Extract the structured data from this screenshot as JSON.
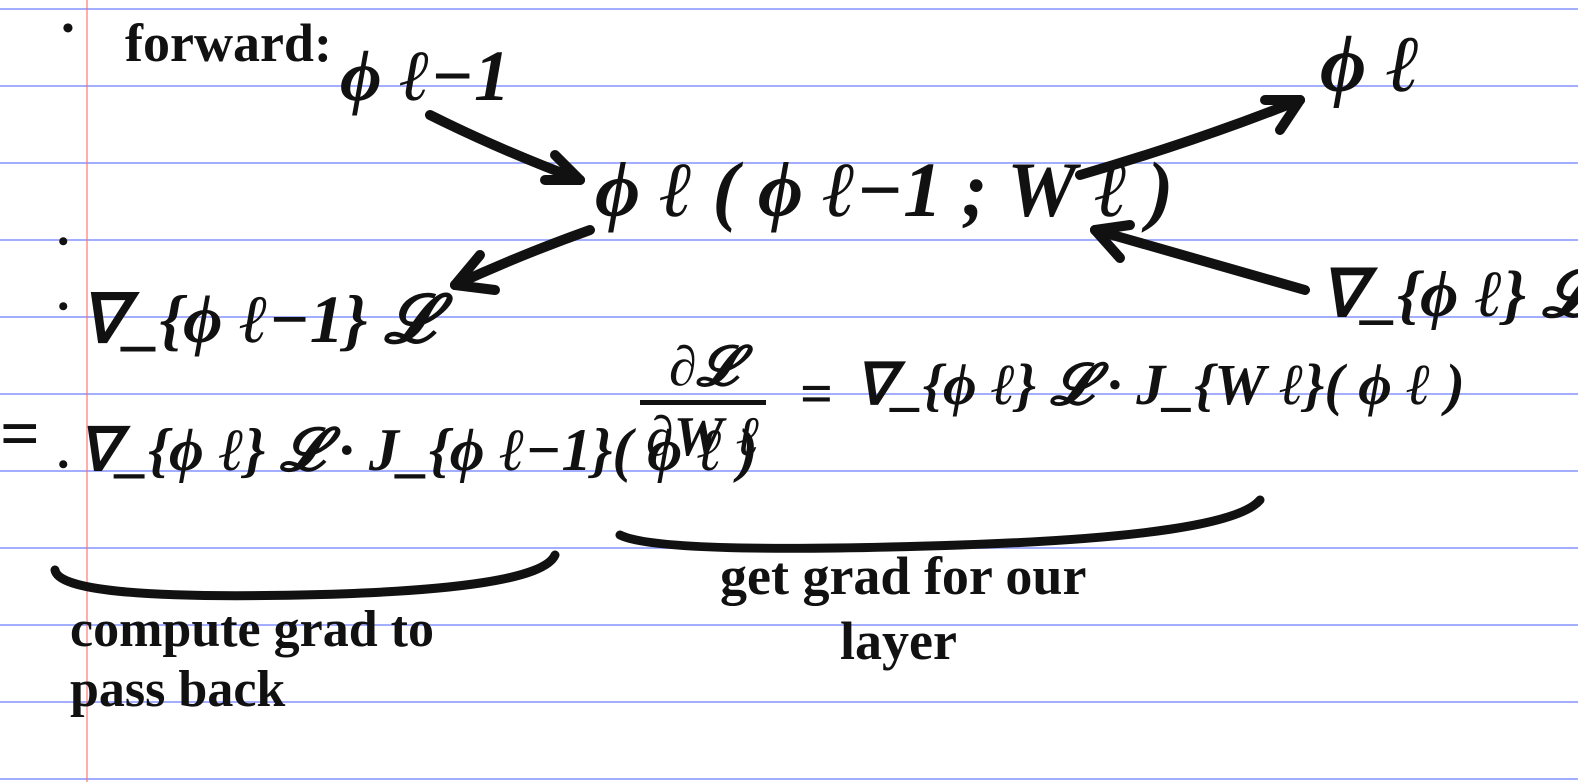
{
  "title_forward": "forward:",
  "phi_prev": "ϕ ℓ−1",
  "phi_curr": "ϕ ℓ",
  "layer_fn": "ϕ ℓ ( ϕ ℓ−1 ; W ℓ )",
  "grad_prev_label": "∇_{ϕ ℓ−1} 𝓛",
  "grad_curr_label": "∇_{ϕ ℓ} 𝓛",
  "equals": "=",
  "pass_back_expr": "∇_{ϕ ℓ} 𝓛 · J_{ϕ ℓ−1}( ϕ ℓ )",
  "weight_grad_lhs": "∂𝓛 / ∂W ℓ",
  "weight_grad_rhs": "∇_{ϕ ℓ} 𝓛 · J_{W ℓ}( ϕ ℓ )",
  "caption_left_1": "compute grad to",
  "caption_left_2": "pass back",
  "caption_right_1": "get grad for our",
  "caption_right_2": "layer"
}
